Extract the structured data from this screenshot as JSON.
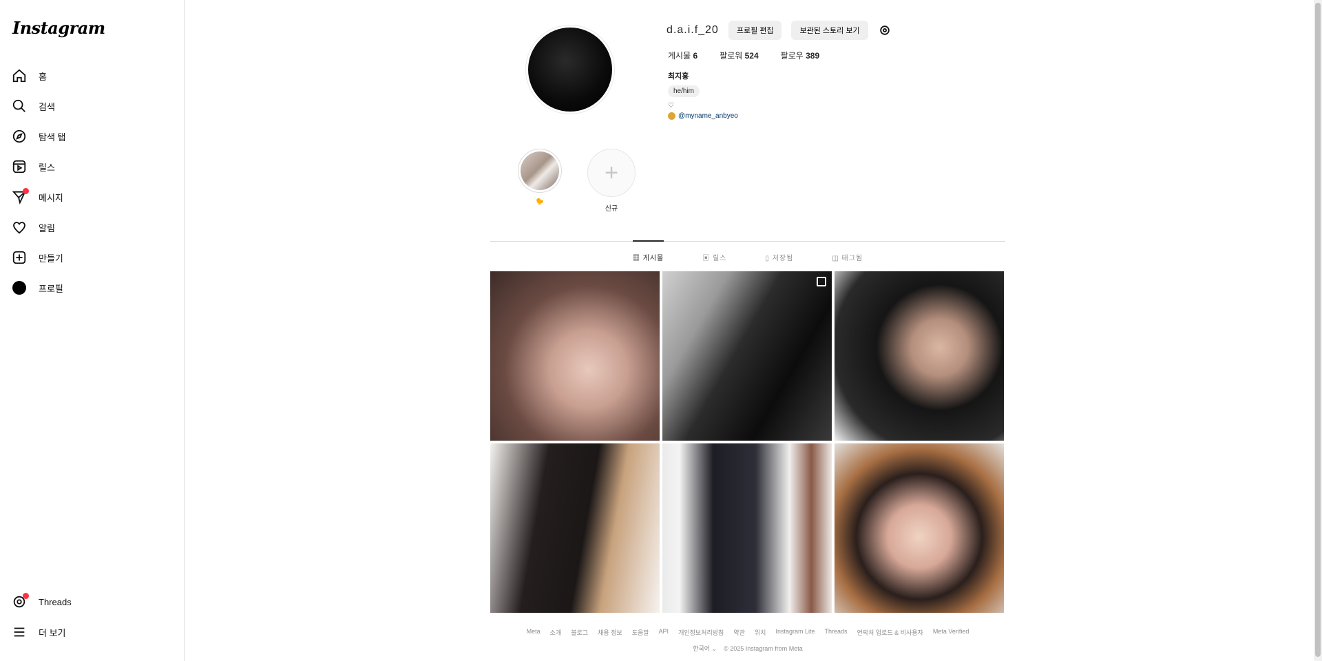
{
  "app": {
    "logo": "Instagram"
  },
  "sidebar": {
    "items": [
      {
        "label": "홈",
        "icon": "home-icon"
      },
      {
        "label": "검색",
        "icon": "search-icon"
      },
      {
        "label": "탐색 탭",
        "icon": "compass-icon"
      },
      {
        "label": "릴스",
        "icon": "reels-icon"
      },
      {
        "label": "메시지",
        "icon": "messenger-icon",
        "badge": true
      },
      {
        "label": "알림",
        "icon": "heart-icon"
      },
      {
        "label": "만들기",
        "icon": "create-icon"
      },
      {
        "label": "프로필",
        "icon": "avatar-icon"
      }
    ],
    "bottom": [
      {
        "label": "Threads",
        "icon": "threads-icon",
        "badge": true
      },
      {
        "label": "더 보기",
        "icon": "menu-icon"
      }
    ]
  },
  "profile": {
    "username": "d.a.i.f_20",
    "edit_button": "프로필 편집",
    "archive_button": "보관된 스토리 보기",
    "stats": {
      "posts_label": "게시물",
      "posts": "6",
      "followers_label": "팔로워",
      "followers": "524",
      "following_label": "팔로우",
      "following": "389"
    },
    "full_name": "최지홍",
    "pronoun": "he/him",
    "bio": "♡",
    "threads_link": "@myname_anbyeo"
  },
  "highlights": [
    {
      "label": "🐤"
    },
    {
      "label": "신규"
    }
  ],
  "tabs": [
    {
      "label": "게시물",
      "active": true
    },
    {
      "label": "릴스"
    },
    {
      "label": "저장됨"
    },
    {
      "label": "태그됨"
    }
  ],
  "footer": {
    "links": [
      "Meta",
      "소개",
      "블로그",
      "채용 정보",
      "도움말",
      "API",
      "개인정보처리방침",
      "약관",
      "위치",
      "Instagram Lite",
      "Threads",
      "연락처 업로드 & 비사용자",
      "Meta Verified"
    ],
    "language": "한국어 ⌄",
    "copyright": "© 2025 Instagram from Meta"
  }
}
